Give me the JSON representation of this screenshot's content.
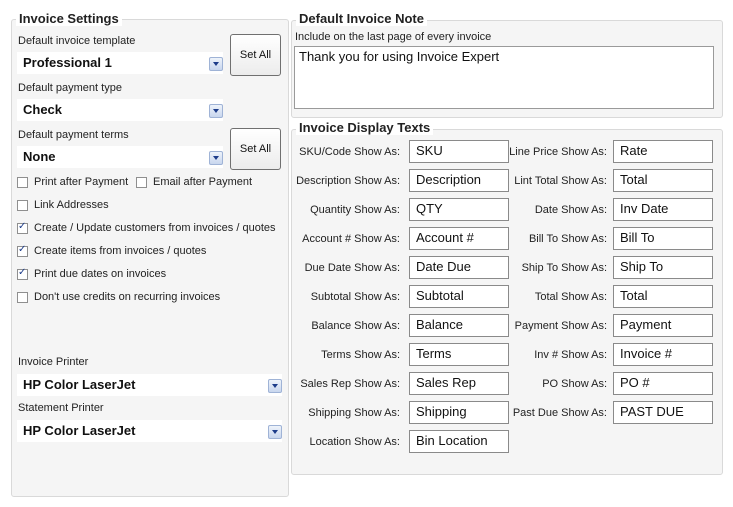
{
  "invoice_settings": {
    "title": "Invoice Settings",
    "template_label": "Default invoice template",
    "template_value": "Professional 1",
    "set_all_label": "Set All",
    "payment_type_label": "Default payment type",
    "payment_type_value": "Check",
    "payment_terms_label": "Default payment terms",
    "payment_terms_value": "None",
    "set_all_label_2": "Set All",
    "checkboxes": [
      {
        "label": "Print after Payment",
        "checked": false
      },
      {
        "label": "Email after Payment",
        "checked": false
      },
      {
        "label": "Link Addresses",
        "checked": false
      },
      {
        "label": "Create / Update customers from invoices /  quotes",
        "checked": true
      },
      {
        "label": "Create items from invoices /  quotes",
        "checked": true
      },
      {
        "label": "Print due dates on invoices",
        "checked": true
      },
      {
        "label": "Don't use credits on recurring invoices",
        "checked": false
      }
    ],
    "invoice_printer_label": "Invoice Printer",
    "invoice_printer_value": "HP Color LaserJet",
    "statement_printer_label": "Statement Printer",
    "statement_printer_value": "HP Color LaserJet"
  },
  "invoice_note": {
    "title": "Default Invoice Note",
    "hint": "Include on the last page of every invoice",
    "text": "Thank you for using Invoice Expert"
  },
  "display_texts": {
    "title": "Invoice Display Texts",
    "left": [
      {
        "label": "SKU/Code Show As:",
        "value": "SKU"
      },
      {
        "label": "Description Show As:",
        "value": "Description"
      },
      {
        "label": "Quantity Show As:",
        "value": "QTY"
      },
      {
        "label": "Account # Show As:",
        "value": "Account #"
      },
      {
        "label": "Due Date Show As:",
        "value": "Date Due"
      },
      {
        "label": "Subtotal Show As:",
        "value": "Subtotal"
      },
      {
        "label": "Balance Show As:",
        "value": "Balance"
      },
      {
        "label": "Terms Show As:",
        "value": "Terms"
      },
      {
        "label": "Sales Rep Show As:",
        "value": "Sales Rep"
      },
      {
        "label": "Shipping Show As:",
        "value": "Shipping"
      },
      {
        "label": "Location Show As:",
        "value": "Bin Location"
      }
    ],
    "right": [
      {
        "label": "Line Price Show As:",
        "value": "Rate"
      },
      {
        "label": "Lint Total Show As:",
        "value": "Total"
      },
      {
        "label": "Date Show As:",
        "value": "Inv Date"
      },
      {
        "label": "Bill To Show As:",
        "value": "Bill To"
      },
      {
        "label": "Ship To Show As:",
        "value": "Ship To"
      },
      {
        "label": "Total Show As:",
        "value": "Total"
      },
      {
        "label": "Payment Show As:",
        "value": "Payment"
      },
      {
        "label": "Inv # Show As:",
        "value": "Invoice #"
      },
      {
        "label": "PO Show As:",
        "value": "PO #"
      },
      {
        "label": "Past Due Show As:",
        "value": "PAST DUE"
      }
    ]
  }
}
